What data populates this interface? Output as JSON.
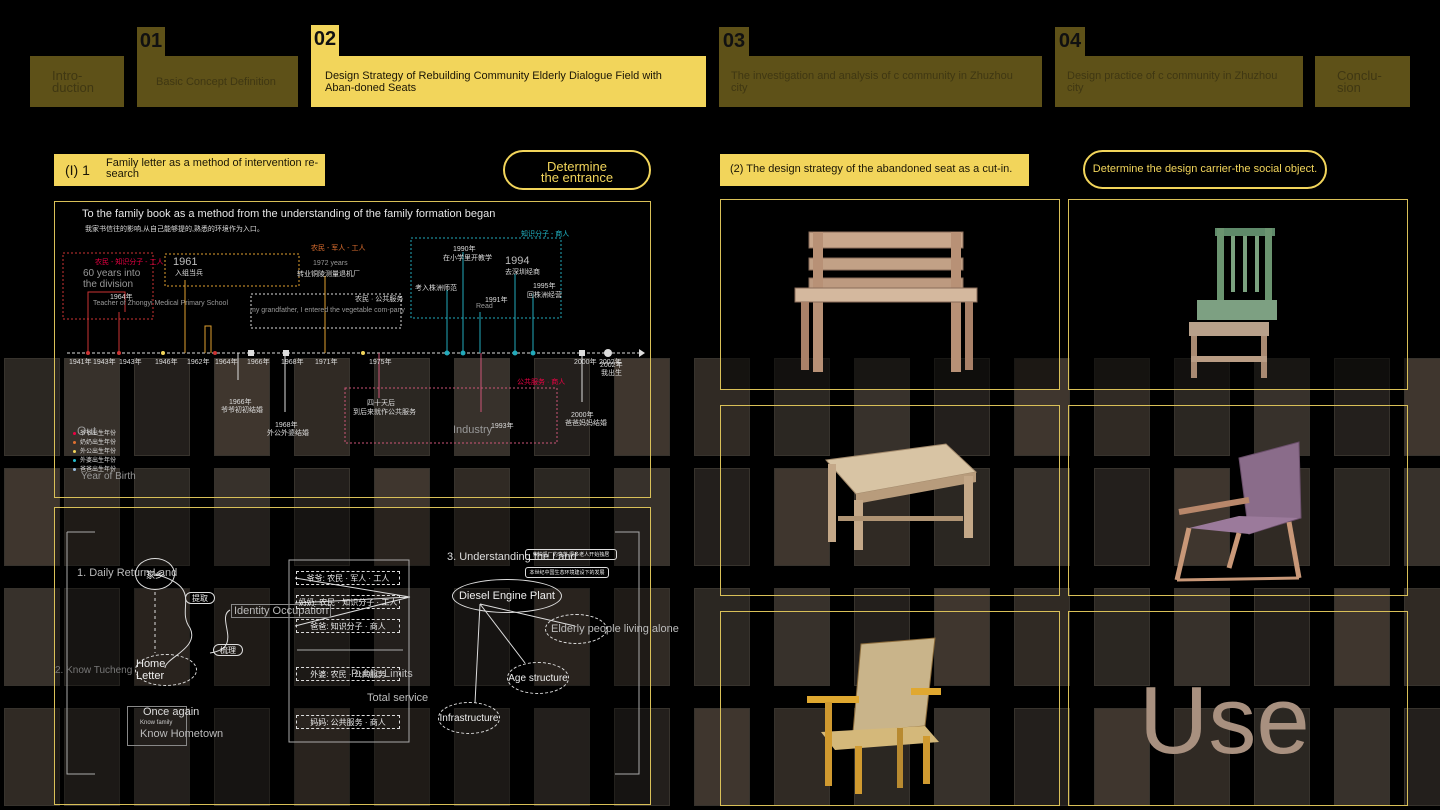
{
  "tabs": [
    {
      "num": "",
      "label": "Intro-\nduction"
    },
    {
      "num": "01",
      "label": "Basic Concept Definition"
    },
    {
      "num": "02",
      "label": "Design Strategy of Rebuilding Community Elderly Dialogue Field with Aban-doned Seats"
    },
    {
      "num": "03",
      "label": "The investigation and analysis of c community in Zhuzhou city"
    },
    {
      "num": "04",
      "label": "Design practice of c community in Zhuzhou city"
    },
    {
      "num": "",
      "label": "Conclu-\nsion"
    }
  ],
  "left": {
    "section_label": "(I) 1",
    "section_title": "Family letter as a method of intervention re-search",
    "pill": "Determine\nthe entrance",
    "timeline_title": "To the family book as a method from the understanding of the family formation began",
    "timeline_subtitle": "我家书信往的影响,从自己能够提的,熟悉的环境作为入口。",
    "timeline_labels": {
      "group1": "农民 - 知识分子 - 工人",
      "group2": "农民 - 军人 - 工人",
      "group3": "知识分子 - 商人",
      "group4": "农民 · 公共服务",
      "group5": "公共服务 · 商人",
      "y60": "60 years into\nthe division",
      "y1961": "1961",
      "y1961b": "入组当兵",
      "y1972": "1972 years",
      "y1972b": "转业铜陵测量退机厂",
      "y1990": "1990年",
      "y1990b": "在小学里开教学",
      "y1994": "1994",
      "y1994b": "去深圳经商",
      "y1995": "1995年",
      "y1995b": "回株洲经营",
      "y1991": "1991年",
      "teacher": "Teacher of Zhongyi Medical Primary School",
      "grandfather": "my grandfather, I entered the vegetable com-pany",
      "industry": "Industry",
      "sishi": "四十天后",
      "sishib": "到后来就作公共服务",
      "y1966": "1966年",
      "y1966b": "爷爷初初结婚",
      "y1968": "1968年",
      "y1968b": "外公外婆结婚",
      "y2000": "2000年",
      "y2000b": "爸爸妈妈结婚",
      "y2002": "2002年",
      "y2002b": "我出生",
      "y1993": "1993年",
      "y1964": "1964年",
      "kaoru": "考入株洲师范",
      "read": "Read",
      "out": "Out",
      "birth": "Year of Birth",
      "legend": [
        "爷爷出生年份",
        "奶奶出生年份",
        "外公出生年份",
        "外婆出生年份",
        "爸爸出生年份"
      ]
    },
    "axis_years": [
      "1941年",
      "1943年",
      "1943年",
      "1946年",
      "1962年",
      "1964年",
      "1966年",
      "1968年",
      "1971年",
      "1975年",
      "2000年",
      "2002年"
    ],
    "concept": {
      "n1": "1. Daily Return Land",
      "home": "家乡",
      "n2": "2. Know Tucheng",
      "home_letter": "Home Letter",
      "once": "Once again",
      "know_family": "Know family",
      "know_home": "Know Hometown",
      "tiqu": "提取",
      "shuli": "梳理",
      "identity": "Identity Occupation",
      "n3": "3. Understanding the Land",
      "diesel": "Diesel Engine Plant",
      "elderly": "Elderly people living alone",
      "age": "Age structure",
      "infra": "Infrastructure",
      "public": "Public Limits",
      "total": "Total service",
      "rows": [
        "爷爷: 农民 · 军人 · 工人",
        "奶奶: 农民 · 知识分子 · 工人",
        "爸爸: 知识分子 · 商人",
        "外婆: 农民 · 公共服务",
        "妈妈: 公共服务 · 商人"
      ],
      "notes": [
        "柴油机厂的衰落,很多老人开始独居",
        "本世纪中国生态环境建设下的发展"
      ]
    }
  },
  "right": {
    "label": "(2) The design strategy of the abandoned seat as a cut-in.",
    "pill": "Determine the design carrier-the social object.",
    "big_word": "Use"
  },
  "colors": {
    "accent": "#f2d55b",
    "dim_accent": "#5e5118",
    "background": "#000000"
  }
}
